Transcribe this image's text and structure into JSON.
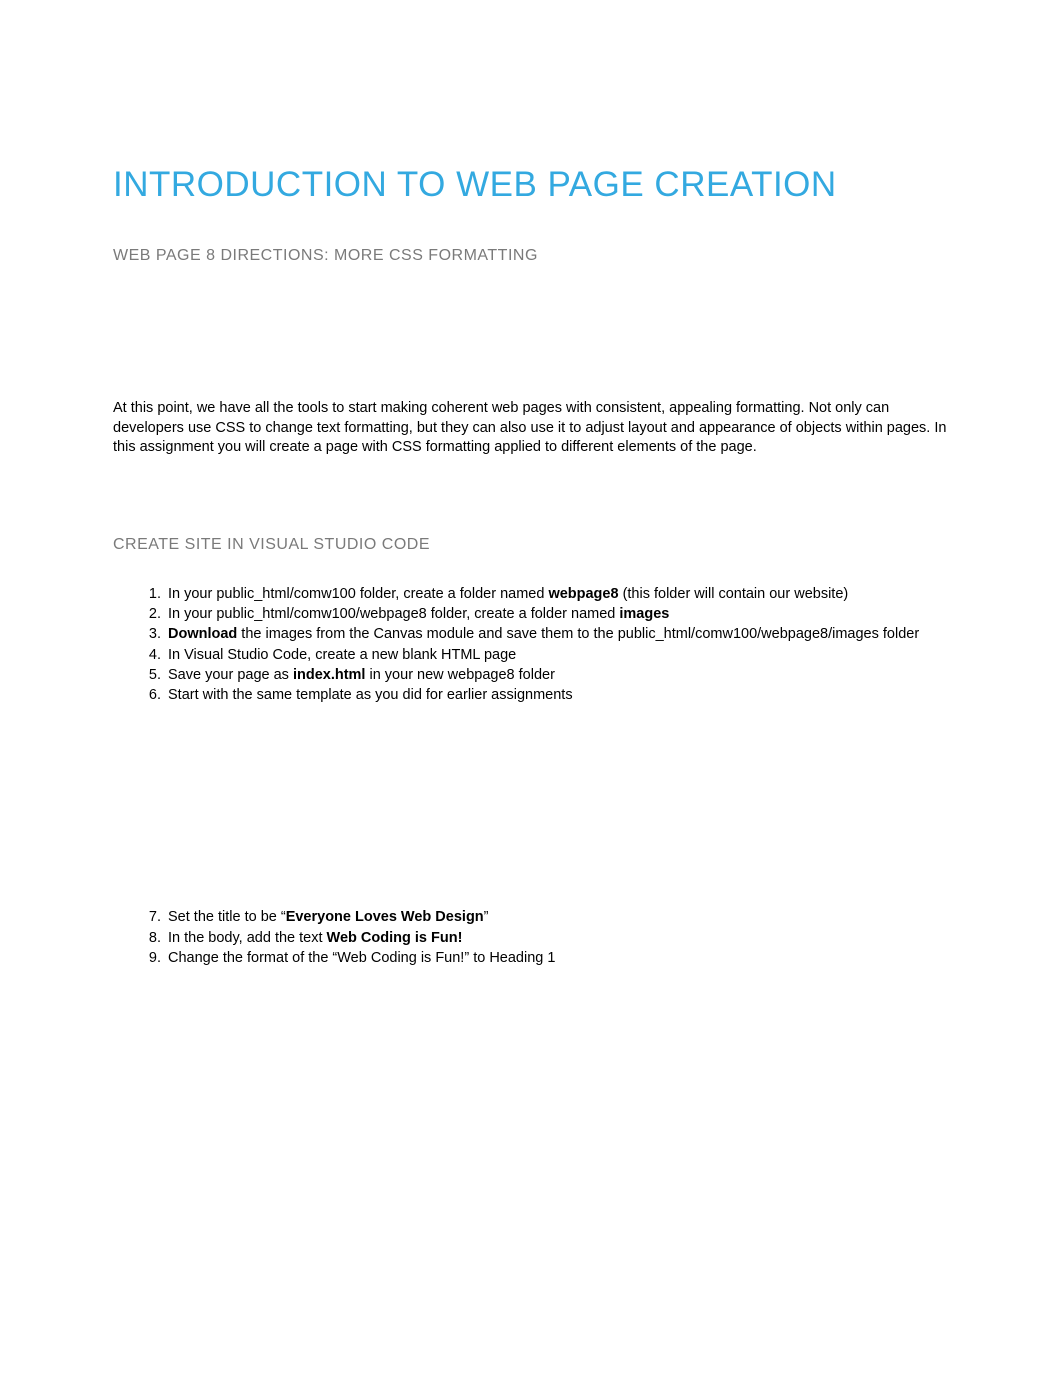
{
  "title": "INTRODUCTION TO WEB PAGE CREATION",
  "subtitle": "WEB PAGE 8 DIRECTIONS:  MORE CSS FORMATTING",
  "intro": "At this point, we have all the tools to start making coherent web pages with consistent, appealing formatting.  Not only can developers use CSS to change text formatting, but they can also use it to adjust layout and appearance of objects within pages.  In this assignment you will create a page with CSS formatting applied to different elements of the page.",
  "section_heading": "CREATE SITE IN VISUAL STUDIO CODE",
  "steps": {
    "s1a": "In your public_html/comw100 folder, create a folder named ",
    "s1b": "webpage8",
    "s1c": " (this folder will contain our website)",
    "s2a": "In your public_html/comw100/webpage8 folder, create a folder named ",
    "s2b": "images",
    "s3a": "Download",
    "s3b": " the images from the Canvas module and save them to the public_html/comw100/webpage8/images folder",
    "s4": "In Visual Studio Code, create a new blank HTML page",
    "s5a": "Save your page as ",
    "s5b": "index.html",
    "s5c": " in your new webpage8 folder",
    "s6": "Start with the same template as you did for earlier assignments",
    "s7a": "Set the title to be “",
    "s7b": "Everyone Loves Web Design",
    "s7c": "”",
    "s8a": "In the body, add the text ",
    "s8b": "Web Coding is Fun!",
    "s9": "Change the format of the “Web Coding is Fun!” to Heading 1"
  }
}
